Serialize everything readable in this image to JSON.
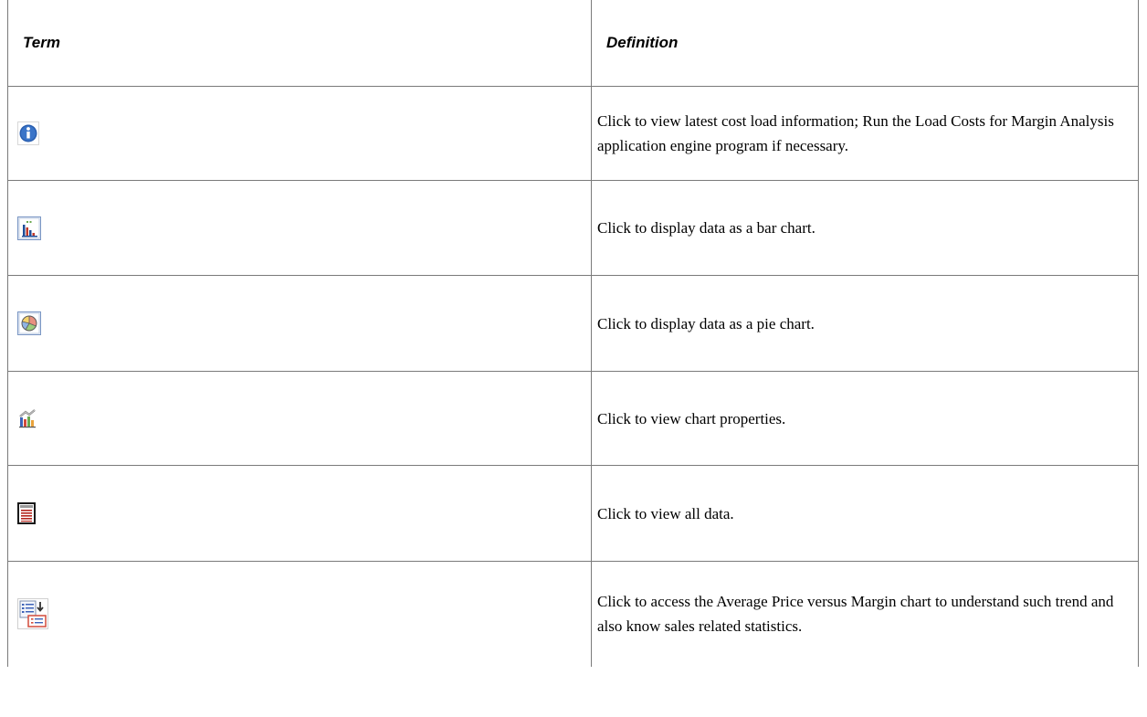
{
  "table": {
    "header": {
      "term": "Term",
      "definition": "Definition"
    },
    "rows": [
      {
        "icon": "information-icon",
        "definition": "Click to view latest cost load information; Run the Load Costs for Margin Analysis application engine program if necessary."
      },
      {
        "icon": "bar-chart-icon",
        "definition": "Click to display data as a bar chart."
      },
      {
        "icon": "pie-chart-icon",
        "definition": "Click to display data as a pie chart."
      },
      {
        "icon": "chart-properties-icon",
        "definition": "Click to view chart properties."
      },
      {
        "icon": "view-all-data-icon",
        "definition": "Click to view all data."
      },
      {
        "icon": "average-price-margin-icon",
        "definition": "Click to access the Average Price versus Margin chart to understand such trend and also know sales related statistics."
      }
    ]
  }
}
